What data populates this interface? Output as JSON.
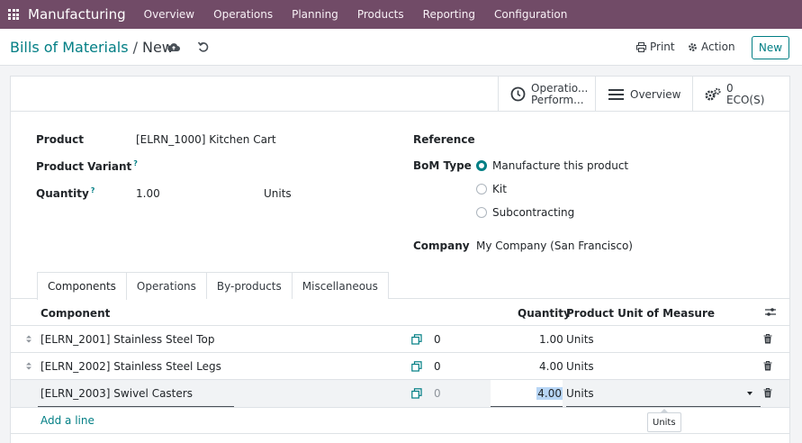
{
  "navbar": {
    "app_name": "Manufacturing",
    "menu": [
      "Overview",
      "Operations",
      "Planning",
      "Products",
      "Reporting",
      "Configuration"
    ]
  },
  "breadcrumb": {
    "parent": "Bills of Materials",
    "separator": "/",
    "current": "New"
  },
  "actions": {
    "print": "Print",
    "action": "Action",
    "new": "New"
  },
  "stat_buttons": {
    "operations_perf_line1": "Operatio...",
    "operations_perf_line2": "Perform...",
    "overview": "Overview",
    "eco_count": "0",
    "eco_label": "ECO(S)"
  },
  "form": {
    "product_label": "Product",
    "product_value": "[ELRN_1000] Kitchen Cart",
    "variant_label": "Product Variant",
    "quantity_label": "Quantity",
    "quantity_value": "1.00",
    "quantity_uom": "Units",
    "reference_label": "Reference",
    "bom_type_label": "BoM Type",
    "bom_type_options": [
      "Manufacture this product",
      "Kit",
      "Subcontracting"
    ],
    "bom_type_selected": "Manufacture this product",
    "company_label": "Company",
    "company_value": "My Company (San Francisco)",
    "help_mark": "?"
  },
  "tabs": [
    "Components",
    "Operations",
    "By-products",
    "Miscellaneous"
  ],
  "active_tab": "Components",
  "table": {
    "headers": {
      "component": "Component",
      "quantity": "Quantity",
      "uom": "Product Unit of Measure"
    },
    "rows": [
      {
        "component": "[ELRN_2001] Stainless Steel Top",
        "availability": "0",
        "quantity": "1.00",
        "uom": "Units"
      },
      {
        "component": "[ELRN_2002] Stainless Steel Legs",
        "availability": "0",
        "quantity": "4.00",
        "uom": "Units"
      },
      {
        "component": "[ELRN_2003] Swivel Casters",
        "availability": "0",
        "quantity": "4.00",
        "uom": "Units"
      }
    ],
    "add_line": "Add a line",
    "tooltip": "Units"
  },
  "colors": {
    "navbar": "#714b67",
    "accent": "#017e84",
    "selection": "#b8d6f5"
  }
}
